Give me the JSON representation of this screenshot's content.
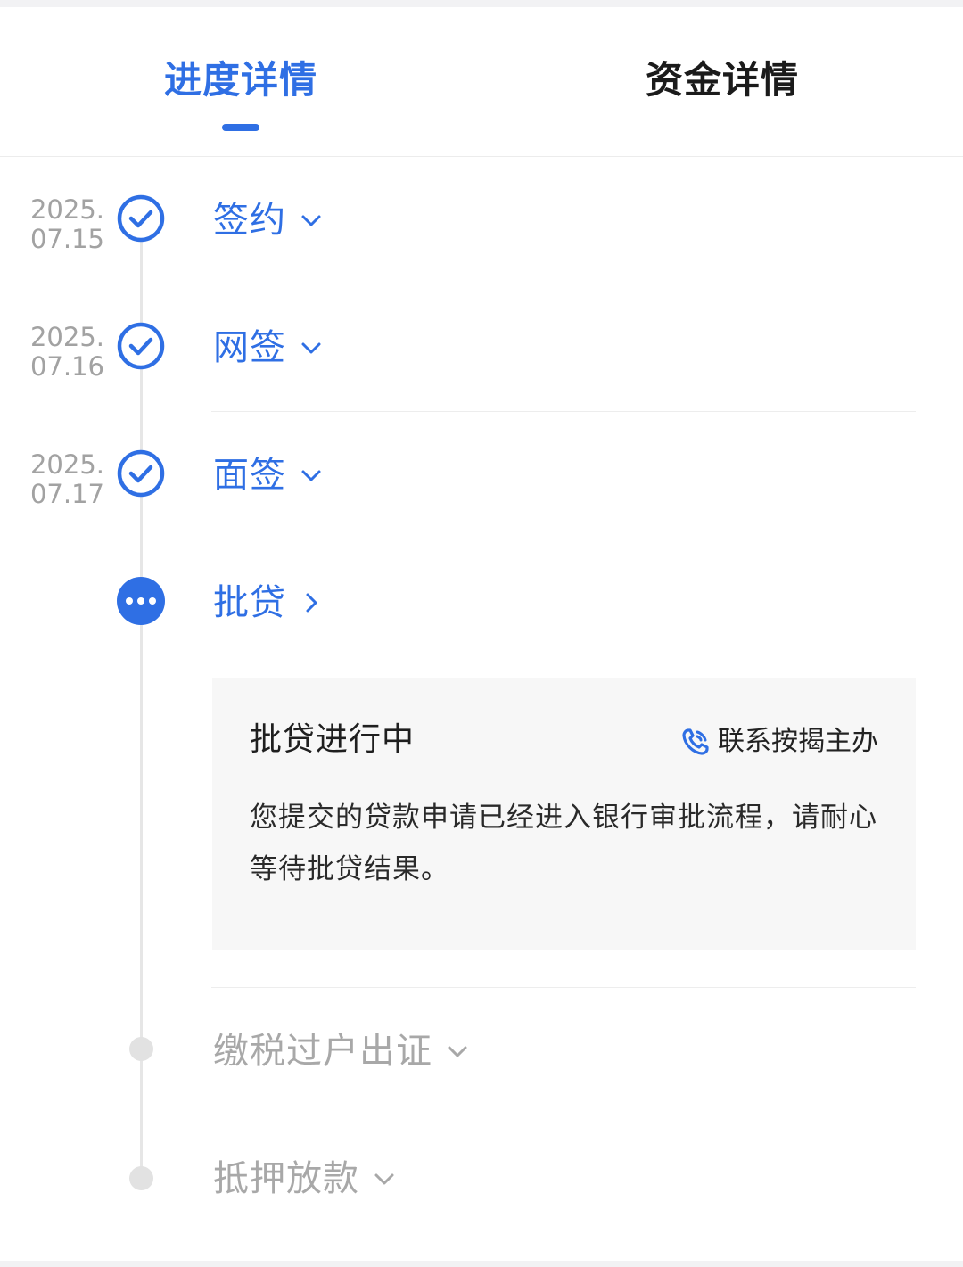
{
  "tabs": [
    {
      "label": "进度详情",
      "active": true
    },
    {
      "label": "资金详情",
      "active": false
    }
  ],
  "colors": {
    "accent": "#2f6fe4",
    "pending": "#a8a8a8",
    "line": "#e6e6e6"
  },
  "steps": [
    {
      "date_year": "2025.",
      "date_day": "07.15",
      "label": "签约",
      "status": "done",
      "chevron": "chevron-down-icon"
    },
    {
      "date_year": "2025.",
      "date_day": "07.16",
      "label": "网签",
      "status": "done",
      "chevron": "chevron-down-icon"
    },
    {
      "date_year": "2025.",
      "date_day": "07.17",
      "label": "面签",
      "status": "done",
      "chevron": "chevron-down-icon"
    },
    {
      "date_year": "",
      "date_day": "",
      "label": "批贷",
      "status": "in-progress",
      "chevron": "chevron-right-icon"
    },
    {
      "date_year": "",
      "date_day": "",
      "label": "缴税过户出证",
      "status": "pending",
      "chevron": "chevron-down-icon"
    },
    {
      "date_year": "",
      "date_day": "",
      "label": "抵押放款",
      "status": "pending",
      "chevron": "chevron-down-icon"
    }
  ],
  "panel": {
    "title": "批贷进行中",
    "contact_label": "联系按揭主办",
    "contact_icon": "phone-icon",
    "body": "您提交的贷款申请已经进入银行审批流程，请耐心等待批贷结果。"
  }
}
